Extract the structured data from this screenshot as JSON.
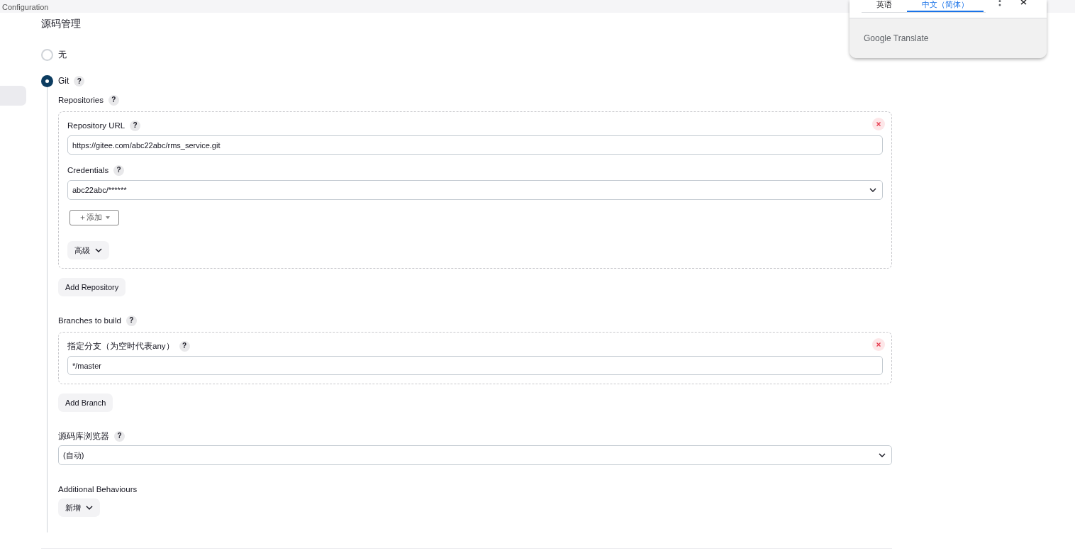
{
  "top_bar": {
    "title": "Configuration"
  },
  "section": {
    "title": "源码管理",
    "options": [
      {
        "label": "无",
        "selected": false
      },
      {
        "label": "Git",
        "selected": true,
        "help": "?"
      }
    ]
  },
  "git": {
    "repositories_label": "Repositories",
    "repositories_help": "?",
    "repositories": [
      {
        "fields": [
          {
            "kind": "text",
            "label": "Repository URL",
            "help": "?",
            "value": "https://gitee.com/abc22abc/rms_service.git"
          },
          {
            "kind": "select",
            "label": "Credentials",
            "help": "?",
            "value": "abc22abc/******"
          }
        ],
        "add_button": "＋添加",
        "advanced_button": "高级"
      }
    ],
    "add_repository": "Add Repository",
    "branches_label": "Branches to build",
    "branches_help": "?",
    "branches": [
      {
        "label": "指定分支（为空时代表any）",
        "help": "?",
        "value": "*/master"
      }
    ],
    "add_branch": "Add Branch",
    "browser": {
      "label": "源码库浏览器",
      "help": "?",
      "value": "(自动)"
    },
    "additional": {
      "label": "Additional Behaviours",
      "button": "新增"
    }
  },
  "translate_popup": {
    "tabs": [
      {
        "label": "英语",
        "selected": false
      },
      {
        "label": "中文（简体）",
        "selected": true
      }
    ],
    "footer": "Google Translate"
  }
}
